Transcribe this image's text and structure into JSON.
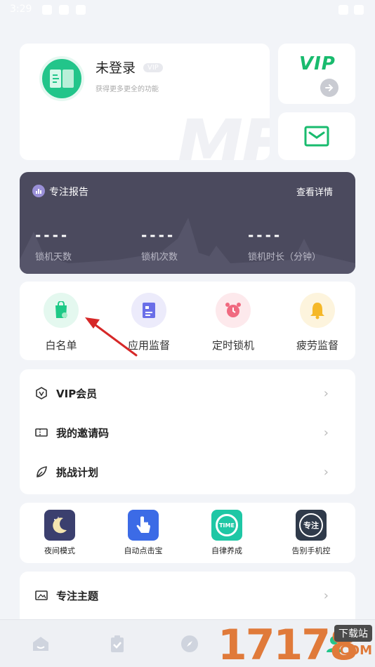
{
  "status_bar": {
    "time": "3:29"
  },
  "profile": {
    "nickname": "未登录",
    "vip_badge": "VIP",
    "subtitle": "获得更多更全的功能",
    "avatar_icon": "book-icon"
  },
  "vip_card": {
    "label": "VIP"
  },
  "report": {
    "title": "专注报告",
    "detail_link": "查看详情",
    "stats": [
      {
        "value": "----",
        "label": "锁机天数"
      },
      {
        "value": "----",
        "label": "锁机次数"
      },
      {
        "value": "----",
        "label": "锁机时长（分钟）"
      }
    ]
  },
  "features": [
    {
      "label": "白名单",
      "icon": "whitelist-bag-icon",
      "color": "#1ec987",
      "bg": "#e4f8ef"
    },
    {
      "label": "应用监督",
      "icon": "app-monitor-icon",
      "color": "#6a6ee8",
      "bg": "#ecebfb"
    },
    {
      "label": "定时锁机",
      "icon": "alarm-clock-icon",
      "color": "#f06a80",
      "bg": "#fde9ec"
    },
    {
      "label": "疲劳监督",
      "icon": "bell-icon",
      "color": "#f5b829",
      "bg": "#fdf4dd"
    }
  ],
  "menu": [
    {
      "label": "VIP会员",
      "icon": "vip-shield-icon"
    },
    {
      "label": "我的邀请码",
      "icon": "ticket-icon"
    },
    {
      "label": "挑战计划",
      "icon": "leaf-icon"
    }
  ],
  "apps": [
    {
      "label": "夜间模式",
      "icon": "moon-icon",
      "badge": ""
    },
    {
      "label": "自动点击宝",
      "icon": "tap-hand-icon",
      "badge": ""
    },
    {
      "label": "自律养成",
      "icon": "time-circle-icon",
      "badge": "TIME"
    },
    {
      "label": "告别手机控",
      "icon": "focus-badge-icon",
      "badge": "专注"
    }
  ],
  "theme_row": {
    "label": "专注主题",
    "icon": "image-frame-icon"
  },
  "watermark": {
    "digits": "17178",
    "site": "下载站",
    "com": ".COM"
  }
}
